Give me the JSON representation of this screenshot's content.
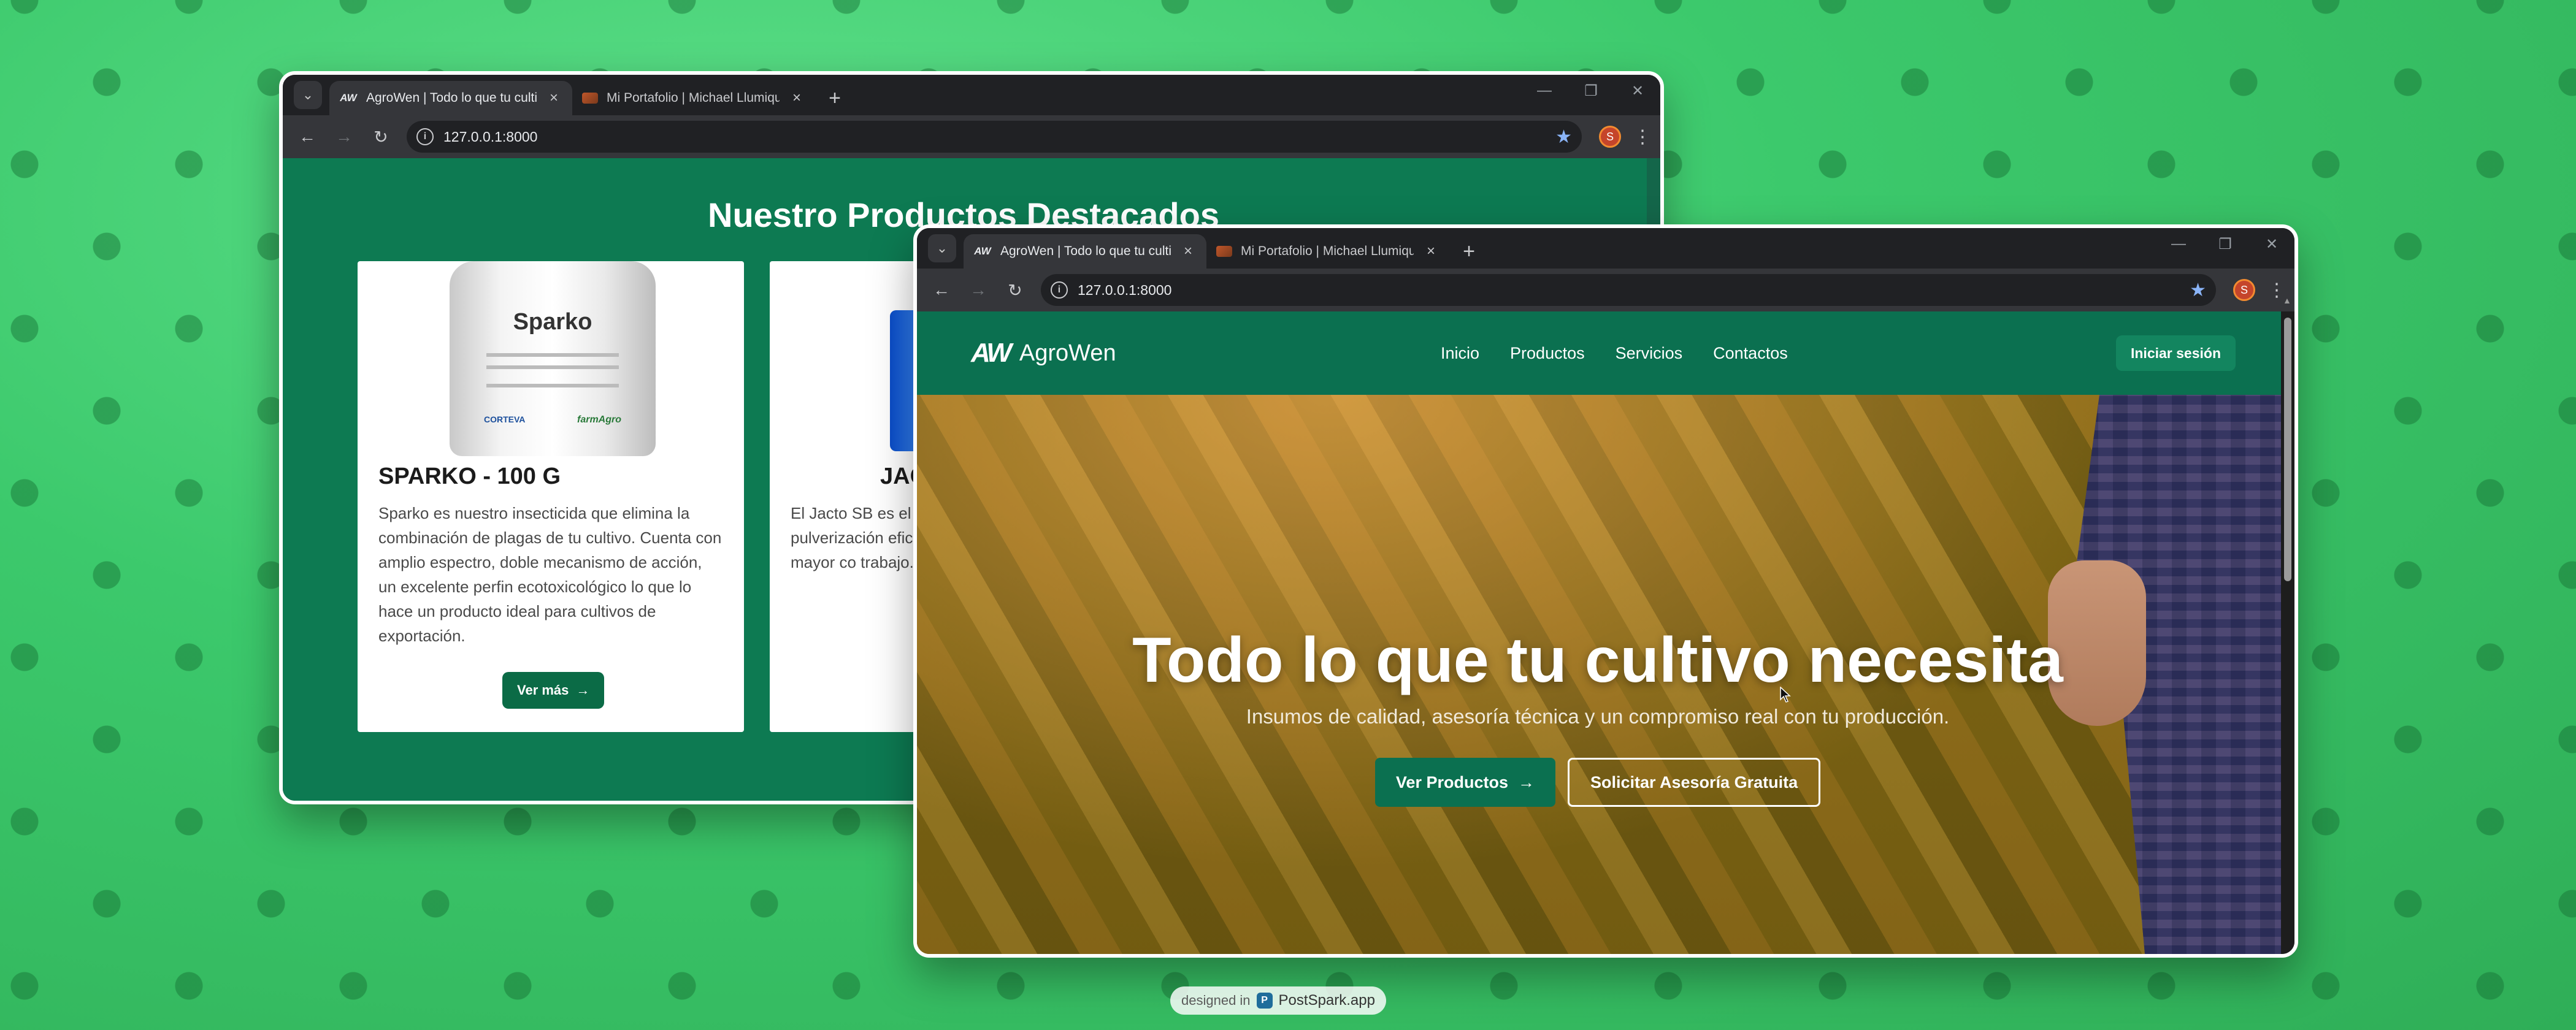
{
  "back_window": {
    "tabs": [
      {
        "title": "AgroWen | Todo lo que tu cultivo necesita",
        "active": true
      },
      {
        "title": "Mi Portafolio | Michael Llumiquinga",
        "active": false
      }
    ],
    "url": "127.0.0.1:8000",
    "profile_initial": "S",
    "section_title": "Nuestro Productos Destacados",
    "products": [
      {
        "name": "SPARKO - 100 G",
        "description": "Sparko es nuestro insecticida que elimina la combinación de plagas de tu cultivo. Cuenta con amplio espectro, doble mecanismo de acción, un excelente perfin ecotoxicológico lo que lo hace un producto ideal para cultivos de exportación.",
        "button": "Ver más",
        "label_brand": "Sparko",
        "label_logo_left": "CORTEVA",
        "label_logo_right": "farmAgro"
      },
      {
        "name": "JAC",
        "description": "El Jacto SB es el p elimina el esfuerz pulverización efic litio-ion es recarg permite mayor co trabajo."
      }
    ],
    "peek_text": "N"
  },
  "front_window": {
    "tabs": [
      {
        "title": "AgroWen | Todo lo que tu cultivo necesita",
        "active": true
      },
      {
        "title": "Mi Portafolio | Michael Llumiquinga",
        "active": false
      }
    ],
    "url": "127.0.0.1:8000",
    "profile_initial": "S",
    "brand": {
      "mark": "AW",
      "name": "AgroWen"
    },
    "nav": [
      "Inicio",
      "Productos",
      "Servicios",
      "Contactos"
    ],
    "login": "Iniciar sesión",
    "hero": {
      "title": "Todo lo que tu cultivo necesita",
      "subtitle": "Insumos de calidad, asesoría técnica y un compromiso real con tu producción.",
      "primary_button": "Ver Productos",
      "secondary_button": "Solicitar Asesoría Gratuita"
    }
  },
  "footer_badge": {
    "prefix": "designed in",
    "brand": "PostSpark.app"
  },
  "colors": {
    "accent": "#0b7050",
    "background": "#3cc96c",
    "browser_chrome": "#202124"
  }
}
